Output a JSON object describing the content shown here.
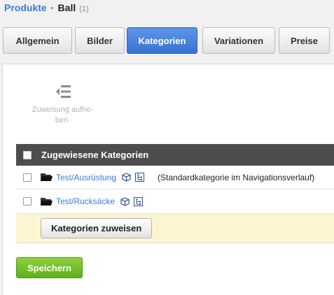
{
  "breadcrumb": {
    "parent": "Produkte",
    "separator": "•",
    "current": "Ball",
    "count": "(1)"
  },
  "tabs": [
    {
      "label": "Allgemein",
      "active": false
    },
    {
      "label": "Bilder",
      "active": false
    },
    {
      "label": "Kategorien",
      "active": true
    },
    {
      "label": "Variationen",
      "active": false
    },
    {
      "label": "Preise",
      "active": false
    }
  ],
  "toolbar": {
    "unassign_label": "Zuweisung aufhe-ben.",
    "unassign_line1": "Zuweisung aufhe-",
    "unassign_line2": "ben."
  },
  "table": {
    "header": "Zugewiesene Kategorien",
    "rows": [
      {
        "category": "Test/Ausrüstung",
        "note": "(Standardkategorie im Navigationsverlauf)"
      },
      {
        "category": "Test/Rucksäcke",
        "note": ""
      }
    ],
    "assign_button": "Kategorien zuweisen"
  },
  "save_button": "Speichern",
  "colors": {
    "accent": "#3873d3",
    "link": "#3a7bd5",
    "header_bg": "#4d4d4d",
    "save_green": "#6cb82a",
    "assign_row_bg": "#fbf6d1"
  },
  "icons": {
    "unassign": "unassign-list-icon",
    "folder": "folder-icon",
    "cube": "cube-icon",
    "tree": "tree-icon"
  }
}
